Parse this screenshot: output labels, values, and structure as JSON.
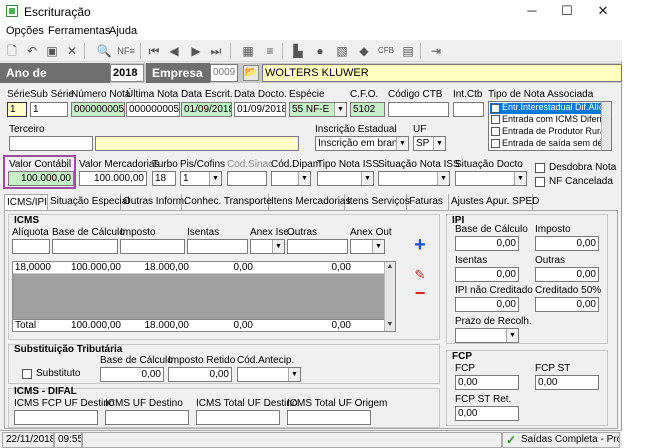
{
  "window": {
    "title": "Escrituração",
    "minimize": "─",
    "maximize": "☐",
    "close": "✕"
  },
  "menu": {
    "opcoes": "Opções",
    "ferramentas": "Ferramentas",
    "ajuda": "Ajuda"
  },
  "toolbar": {
    "nfe_label": "NF≡"
  },
  "year_bar": {
    "ano_label": "Ano de Movimento",
    "ano_value": "2018",
    "empresa_label": "Empresa",
    "empresa_code": "0009",
    "empresa_name": "WOLTERS KLUWER"
  },
  "header": {
    "serie": {
      "label": "Série",
      "value": "1"
    },
    "sub_serie": {
      "label": "Sub Série",
      "value": "1"
    },
    "numero_nota": {
      "label": "Número Nota",
      "value": "000000005"
    },
    "ultima_nota": {
      "label": "Última Nota",
      "value": "000000005"
    },
    "data_escrit": {
      "label": "Data Escrit.",
      "value": "01/09/2018"
    },
    "data_docto": {
      "label": "Data Docto.",
      "value": "01/09/2018"
    },
    "especie": {
      "label": "Espécie",
      "code": "55",
      "value": "NF-E"
    },
    "cfo": {
      "label": "C.F.O.",
      "value": "5102"
    },
    "codigo_ctb": {
      "label": "Código CTB",
      "value": ""
    },
    "int_ctb": {
      "label": "Int.Ctb",
      "value": ""
    },
    "tipo_nota": {
      "label": "Tipo de Nota Associada",
      "options": [
        "Entr.Interestadual Dif.Alíq",
        "Entrada com ICMS Diferido",
        "Entrada de Produtor Rural",
        "Entrada de saída sem débi"
      ]
    }
  },
  "terceiro": {
    "label": "Terceiro",
    "code": "",
    "name": ""
  },
  "inscricao": {
    "label": "Inscrição Estadual",
    "value": "Inscrição em branco"
  },
  "uf": {
    "label": "UF",
    "value": "SP"
  },
  "values_row": {
    "valor_contabil": {
      "label": "Valor Contábil",
      "value": "100.000,00"
    },
    "valor_mercadorias": {
      "label": "Valor Mercadorias",
      "value": "100.000,00"
    },
    "turbo": {
      "label": "Turbo",
      "value": "18"
    },
    "pis_cofins": {
      "label": "Pis/Cofins",
      "value": "1"
    },
    "cod_sinac": {
      "label": "Cod.Sinac",
      "value": ""
    },
    "cod_dipam": {
      "label": "Cód.Dipam",
      "value": ""
    },
    "tipo_nota_iss": {
      "label": "Tipo Nota ISS",
      "value": ""
    },
    "situacao_nota_iss": {
      "label": "Situação Nota ISS",
      "value": ""
    },
    "situacao_docto": {
      "label": "Situação Docto",
      "value": ""
    },
    "desdobra_nota": "Desdobra Nota",
    "nf_cancelada": "NF Cancelada"
  },
  "tabs": [
    "ICMS/IPI",
    "Situação Especial",
    "Outras Inform.",
    "Conhec. Transporte",
    "Itens Mercadorias",
    "Itens Serviços",
    "Faturas",
    "Ajustes Apur. SPED"
  ],
  "icms": {
    "title": "ICMS",
    "columns": [
      "Alíquota",
      "Base de Cálculo",
      "Imposto",
      "Isentas",
      "Anex Ise",
      "Outras",
      "Anex Out"
    ],
    "rows": [
      [
        "18,0000",
        "100.000,00",
        "18.000,00",
        "0,00",
        "0,00"
      ]
    ],
    "total": {
      "label": "Total",
      "values": [
        "100.000,00",
        "18.000,00",
        "0,00",
        "0,00"
      ]
    }
  },
  "ipi": {
    "title": "IPI",
    "base_calculo": {
      "label": "Base de Cálculo",
      "value": "0,00"
    },
    "imposto": {
      "label": "Imposto",
      "value": "0,00"
    },
    "isentas": {
      "label": "Isentas",
      "value": "0,00"
    },
    "outras": {
      "label": "Outras",
      "value": "0,00"
    },
    "ipi_nao_creditado": {
      "label": "IPI não Creditado",
      "value": "0,00"
    },
    "creditado_50": {
      "label": "Creditado 50%",
      "value": "0,00"
    },
    "prazo_recolh": {
      "label": "Prazo de Recolh.",
      "value": ""
    }
  },
  "substituicao": {
    "title": "Substituição Tributária",
    "substituto": "Substituto",
    "base_calculo": {
      "label": "Base de Cálculo",
      "value": "0,00"
    },
    "imposto_retido": {
      "label": "Imposto Retido",
      "value": "0,00"
    },
    "cod_antecip": {
      "label": "Cód.Antecip.",
      "value": ""
    }
  },
  "difal": {
    "title": "ICMS - DIFAL",
    "fcp_uf_destino": "ICMS FCP UF Destino",
    "uf_destino": "ICMS UF Destino",
    "total_uf_destino": "ICMS Total UF Destino",
    "total_uf_origem": "ICMS Total UF Origem"
  },
  "fcp": {
    "title": "FCP",
    "fcp": {
      "label": "FCP",
      "value": "0,00"
    },
    "fcp_st": {
      "label": "FCP ST",
      "value": "0,00"
    },
    "fcp_st_ret": {
      "label": "FCP ST Ret.",
      "value": "0,00"
    }
  },
  "status_bar": {
    "date": "22/11/2018",
    "time": "09:55",
    "message": "Saídas Completa - Pros"
  }
}
